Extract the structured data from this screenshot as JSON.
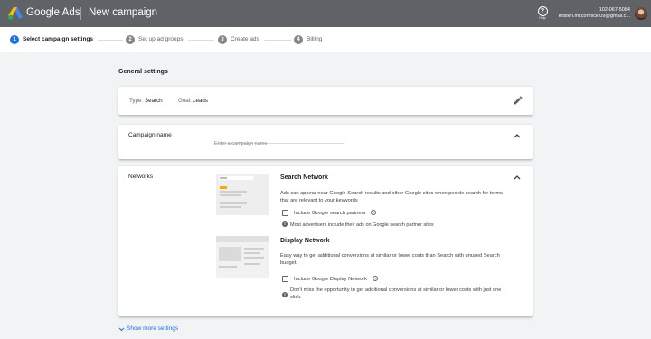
{
  "header": {
    "brand": "Google Ads",
    "page_title": "New campaign",
    "help_label": "Help",
    "account_id": "102-067-5084",
    "account_email": "kristen.mccormick.09@gmail.c...",
    "colors": {
      "topbar": "#5f6368",
      "logo_blue": "#4285f4",
      "logo_yellow": "#fbbc04",
      "logo_green": "#34a853"
    }
  },
  "steps": [
    {
      "num": "1",
      "label": "Select campaign settings",
      "active": true
    },
    {
      "num": "2",
      "label": "Set up ad groups",
      "active": false
    },
    {
      "num": "3",
      "label": "Create ads",
      "active": false
    },
    {
      "num": "4",
      "label": "Billing",
      "active": false
    }
  ],
  "general_settings": {
    "title": "General settings",
    "type_label": "Type:",
    "type_value": "Search",
    "goal_label": "Goal:",
    "goal_value": "Leads",
    "edit_icon": "pencil-icon"
  },
  "campaign_name": {
    "label": "Campaign name",
    "placeholder": "Enter a campaign name",
    "value": ""
  },
  "networks": {
    "label": "Networks",
    "search": {
      "title": "Search Network",
      "description": "Ads can appear near Google Search results and other Google sites when people search for terms that are relevant to your keywords",
      "checkbox_label": "Include Google search partners",
      "checked": false,
      "note": "Most advertisers include their ads on Google search partner sites"
    },
    "display": {
      "title": "Display Network",
      "description": "Easy way to get additional conversions at similar or lower costs than Search with unused Search budget.",
      "checkbox_label": "Include Google Display Network",
      "checked": false,
      "note": "Don't miss the opportunity to get additional conversions at similar or lower costs with just one click."
    }
  },
  "show_more": "Show more settings",
  "accent_color": "#1a73e8"
}
